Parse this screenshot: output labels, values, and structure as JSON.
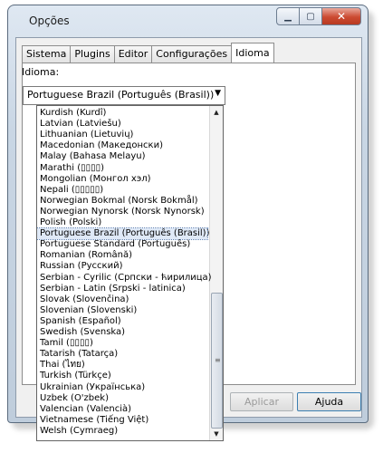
{
  "window": {
    "title": "Opções"
  },
  "tabs": [
    "Sistema",
    "Plugins",
    "Editor",
    "Configurações",
    "Idioma"
  ],
  "active_tab": "Idioma",
  "language": {
    "label": "Idioma:",
    "selected": "Portuguese Brazil (Português (Brasil))",
    "options": [
      "Kurdish (Kurdî)",
      "Latvian (Latviešu)",
      "Lithuanian (Lietuvių)",
      "Macedonian (Македонски)",
      "Malay (Bahasa Melayu)",
      "Marathi (▯▯▯▯)",
      "Mongolian (Монгол хэл)",
      "Nepali (▯▯▯▯▯)",
      "Norwegian Bokmal (Norsk Bokmål)",
      "Norwegian Nynorsk (Norsk Nynorsk)",
      "Polish (Polski)",
      "Portuguese Brazil (Português (Brasil))",
      "Portuguese Standard (Português)",
      "Romanian (Română)",
      "Russian (Русский)",
      "Serbian - Cyrilic (Српски - ћирилица)",
      "Serbian - Latin (Srpski - latinica)",
      "Slovak (Slovenčina)",
      "Slovenian (Slovenski)",
      "Spanish (Español)",
      "Swedish (Svenska)",
      "Tamil (▯▯▯▯)",
      "Tatarish (Tatarça)",
      "Thai (ไทย)",
      "Turkish (Türkçe)",
      "Ukrainian (Українська)",
      "Uzbek (O'zbek)",
      "Valencian (Valencià)",
      "Vietnamese (Tiếng Việt)",
      "Welsh (Cymraeg)"
    ]
  },
  "buttons": {
    "apply": "Aplicar",
    "help": "Ajuda"
  },
  "icons": {
    "minimize": "minimize-icon",
    "maximize": "maximize-icon",
    "close": "close-icon",
    "scroll_up": "scroll-up-arrow-icon",
    "scroll_down": "scroll-down-arrow-icon",
    "dropdown": "chevron-down-icon"
  }
}
